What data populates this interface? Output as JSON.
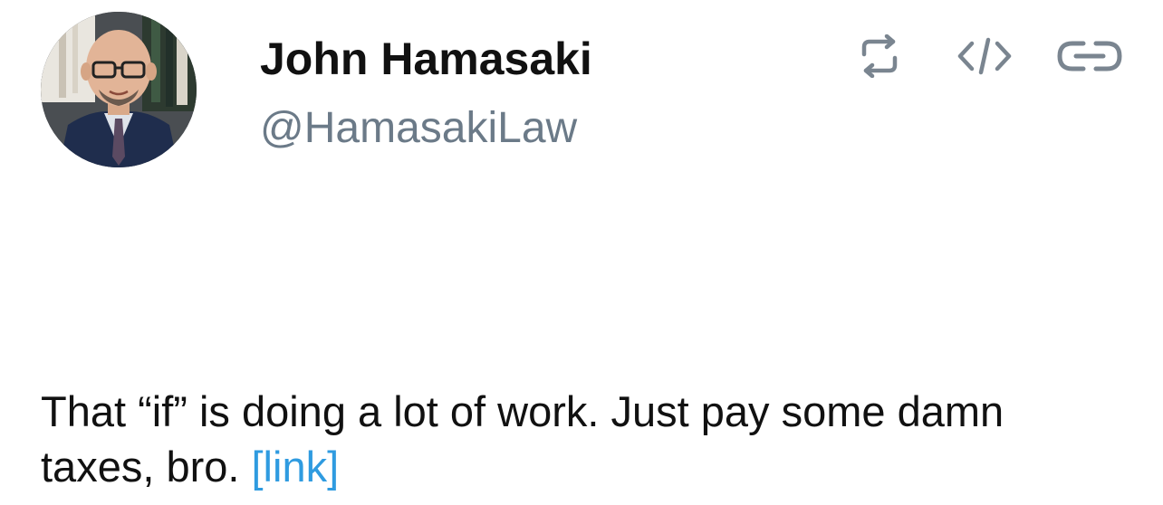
{
  "tweet": {
    "author_name": "John Hamasaki",
    "author_handle": "@HamasakiLaw",
    "text": "That “if” is doing a lot of work. Just pay some damn taxes, bro. ",
    "link_text": "[link]"
  },
  "actions": {
    "retweet_icon": "retweet-icon",
    "embed_icon": "code-icon",
    "link_icon": "link-icon"
  },
  "colors": {
    "text": "#111111",
    "handle": "#6b7a88",
    "link": "#2f9be0",
    "icon": "#7a8590"
  }
}
